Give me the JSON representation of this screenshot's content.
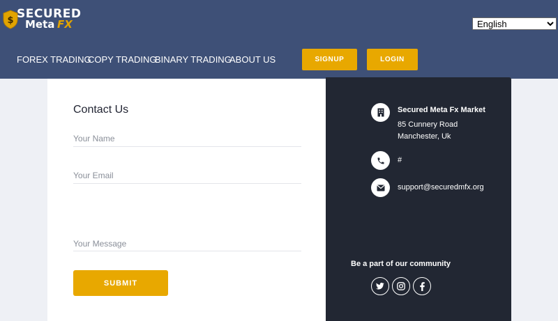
{
  "brand": {
    "line1": "SECURED",
    "line2": "Meta",
    "line3": "FX",
    "colors": {
      "header": "#3e5077",
      "accent": "#e8a800",
      "dark": "#222733"
    }
  },
  "language": {
    "selected": "English",
    "icon": "chevron-down-icon"
  },
  "nav": {
    "items": [
      "FOREX TRADING",
      "COPY TRADING",
      "BINARY TRADING",
      "ABOUT US"
    ],
    "signup_label": "SIGNUP",
    "login_label": "LOGIN"
  },
  "contact": {
    "title": "Contact Us",
    "name_placeholder": "Your Name",
    "email_placeholder": "Your Email",
    "message_placeholder": "Your Message",
    "submit_label": "SUBMIT"
  },
  "info": {
    "company": "Secured Meta Fx Market",
    "address_line1": "85 Cunnery Road",
    "address_line2": "Manchester, Uk",
    "phone": "#",
    "email": "support@securedmfx.org",
    "community_title": "Be a part of our community",
    "icons": [
      "building-icon",
      "phone-icon",
      "envelope-icon"
    ],
    "social": [
      "twitter-icon",
      "instagram-icon",
      "facebook-icon"
    ]
  }
}
